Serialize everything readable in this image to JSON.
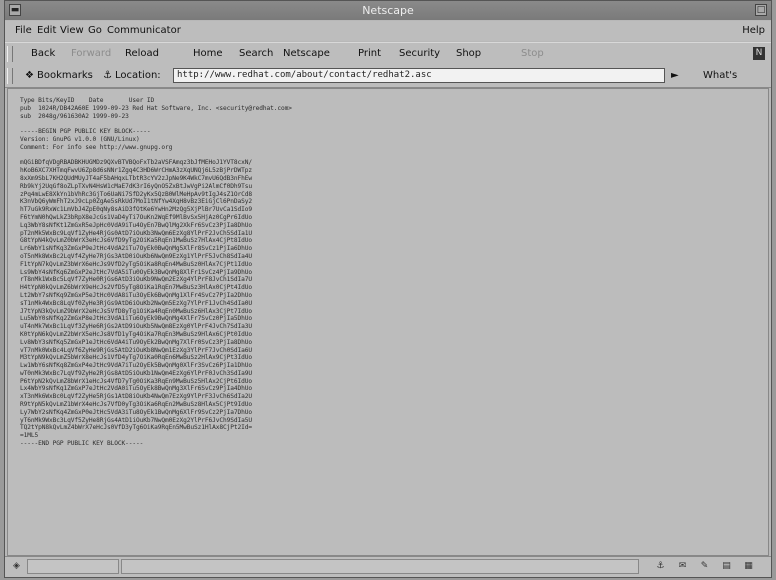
{
  "window": {
    "title": "Netscape"
  },
  "menu": {
    "items": [
      "File",
      "Edit",
      "View",
      "Go",
      "Communicator"
    ],
    "help": "Help"
  },
  "toolbar": {
    "back": "Back",
    "forward": "Forward",
    "reload": "Reload",
    "home": "Home",
    "search": "Search",
    "netscape": "Netscape",
    "print": "Print",
    "security": "Security",
    "shop": "Shop",
    "stop": "Stop"
  },
  "location": {
    "bookmarks": "Bookmarks",
    "location_label": "Location:",
    "url": "http://www.redhat.com/about/contact/redhat2.asc",
    "whats_related": "What's Related"
  },
  "page": {
    "header_lines": [
      "Type Bits/KeyID    Date       User ID",
      "pub  1024R/DB42A60E 1999-09-23 Red Hat Software, Inc. <security@redhat.com>",
      "sub  2048g/961630A2 1999-09-23",
      "",
      "-----BEGIN PGP PUBLIC KEY BLOCK-----",
      "Version: GnuPG v1.0.0 (GNU/Linux)",
      "Comment: For info see http://www.gnupg.org",
      ""
    ],
    "key_lines": [
      "mQGiBDfqVDgRBADBKHUGMDz9QXvBTVBQoFxTb2aVSFAmqz3bJfMEHoJ1YVT8cxN/",
      "hKoB6XC7XHTmqFwvU6Zp8d6sNNr1Zgq4C3HD6WrCHmA3zXqUNQj6L5zBjPrDWTpz",
      "8xXm9SbL7KH2QUdMUyJT4aF5bAHqxLTbtR3cYV2zJpNe9K4WkC7mvU6QdB3nFhEw",
      "Rb9kYj2UqGf8oZLpTXvN4HsW1cMaE7dK3rI6yQnO5ZxBtJwVgPi2AlmCf0Dh9Tsu",
      "zPq4mLwE8XkYn1bVhRc3GjTo6UaNi7SfD2yKx5QzB0WlMeHpAv9tIgJ4sZ1OrCd8",
      "K3nVbQ6yWmFhT2xJ9cLp0ZgAe5sRkUd7MoI1tNfYw4XqH8vBz3EiGjCl6PnDaSy2",
      "hT7uGk9RxWc1LmVbJ4ZpE0qNy8sAiD3fOtKe6YwHn2MzQg5XjPlBr7UvCa1SdIo9",
      "F6tYmN0hQwLkZ3bRpX8eJcGs1VaD4yTi7OuKn2WqEf9MlBvSx5HjAz0CgPr6IdUo",
      "Lq3WbY8sNfKt1ZmGxR5eJpHc0VdA9iTu4OyEn7BwQlMg2XkFr6SvCz3PjIa8DhUo",
      "pT2nMk5WxBc9LqVf1ZyHe4RjGs0AtD7iOuKb3NwQm6EzXg8YlPrF2JvCh5SdIa1U",
      "G8tYpN4kQvLmZ0bWrX3eHcJs6VfD9yTg2OiKa5RqEn1MwBuSz7HlAx4CjPt8IdUo",
      "Lr6WbY1sNfKq3ZmGxP9eJtHc4VdA2iTu7OyEk0BwQnMg5XlFr8SvCz1PjIa6DhUo",
      "oT5nMk8WxBc2LqVf4ZyHe7RjGs3AtD0iOuKb6NwQm9EzXg1YlPrF5JvCh8SdIa4U",
      "F1tYpN7kQvLmZ3bWrX6eHcJs9VfD2yTg5OiKa8RqEn4MwBuSz0HlAx7CjPt1IdUo",
      "Ls9WbY4sNfKq6ZmGxP2eJtHc7VdA5iTu0OyEk3BwQnMg8XlFr1SvCz4PjIa9DhUo",
      "rT8nMk1WxBc5LqVf7ZyHe0RjGs6AtD3iOuKb9NwQm2EzXg4YlPrF8JvCh1SdIa7U",
      "H4tYpN0kQvLmZ6bWrX9eHcJs2VfD5yTg8OiKa1RqEn7MwBuSz3HlAx0CjPt4IdUo",
      "Lt2WbY7sNfKq9ZmGxP5eJtHc0VdA8iTu3OyEk6BwQnMg1XlFr4SvCz7PjIa2DhUo",
      "sT1nMk4WxBc8LqVf0ZyHe3RjGs9AtD6iOuKb2NwQm5EzXg7YlPrF1JvCh4SdIa0U",
      "J7tYpN3kQvLmZ9bWrX2eHcJs5VfD8yTg1OiKa4RqEn0MwBuSz6HlAx3CjPt7IdUo",
      "Lu5WbY0sNfKq2ZmGxP8eJtHc3VdA1iTu6OyEk9BwQnMg4XlFr7SvCz0PjIa5DhUo",
      "uT4nMk7WxBc1LqVf3ZyHe6RjGs2AtD9iOuKb5NwQm8EzXg0YlPrF4JvCh7SdIa3U",
      "K0tYpN6kQvLmZ2bWrX5eHcJs8VfD1yTg4OiKa7RqEn3MwBuSz9HlAx6CjPt0IdUo",
      "Lv8WbY3sNfKq5ZmGxP1eJtHc6VdA4iTu9OyEk2BwQnMg7XlFr0SvCz3PjIa8DhUo",
      "vT7nMk0WxBc4LqVf6ZyHe9RjGs5AtD2iOuKb8NwQm1EzXg3YlPrF7JvCh0SdIa6U",
      "M3tYpN9kQvLmZ5bWrX8eHcJs1VfD4yTg7OiKa0RqEn6MwBuSz2HlAx9CjPt3IdUo",
      "Lw1WbY6sNfKq8ZmGxP4eJtHc9VdA7iTu2OyEk5BwQnMg0XlFr3SvCz6PjIa1DhUo",
      "wT0nMk3WxBc7LqVf9ZyHe2RjGs8AtD5iOuKb1NwQm4EzXg6YlPrF0JvCh3SdIa9U",
      "P6tYpN2kQvLmZ8bWrX1eHcJs4VfD7yTg0OiKa3RqEn9MwBuSz5HlAx2CjPt6IdUo",
      "Lx4WbY9sNfKq1ZmGxP7eJtHc2VdA0iTu5OyEk8BwQnMg3XlFr6SvCz9PjIa4DhUo",
      "xT3nMk6WxBc0LqVf2ZyHe5RjGs1AtD8iOuKb4NwQm7EzXg9YlPrF3JvCh6SdIa2U",
      "R9tYpN5kQvLmZ1bWrX4eHcJs7VfD0yTg3OiKa6RqEn2MwBuSz8HlAx5CjPt9IdUo",
      "Ly7WbY2sNfKq4ZmGxP0eJtHc5VdA3iTu8OyEk1BwQnMg6XlFr9SvCz2PjIa7DhUo",
      "yT6nMk9WxBc3LqVf5ZyHe8RjGs4AtD1iOuKb7NwQm0EzXg2YlPrF6JvCh9SdIa5U",
      "TQ2tYpN8kQvLmZ4bWrX7eHcJs0VfD3yTg6OiKa9RqEn5MwBuSz1HlAx8CjPt2Id=",
      "=1ML5",
      "-----END PGP PUBLIC KEY BLOCK-----"
    ]
  },
  "colors": {
    "titlebar": "#7a7a7a",
    "chrome": "#bdbdbd",
    "content": "#bcbcbc"
  }
}
